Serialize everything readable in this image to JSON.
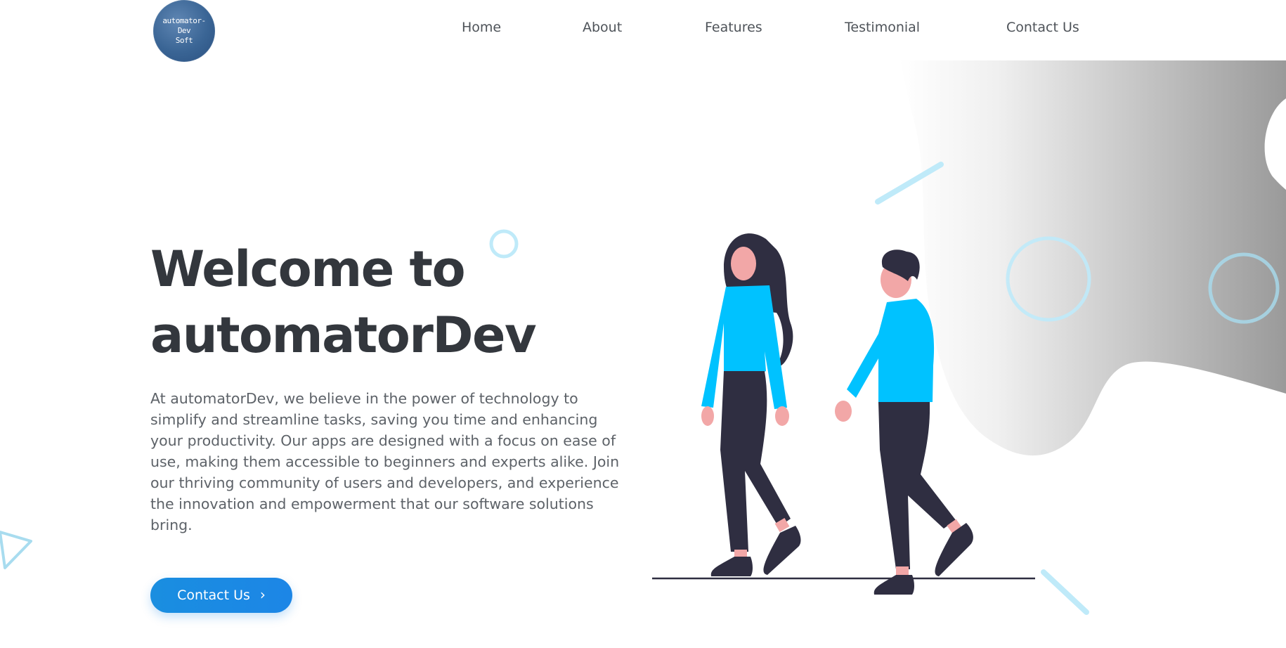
{
  "brand": {
    "logo_text_line1": "automator-Dev",
    "logo_text_line2": "Soft"
  },
  "nav": {
    "items": [
      {
        "label": "Home"
      },
      {
        "label": "About"
      },
      {
        "label": "Features"
      },
      {
        "label": "Testimonial"
      },
      {
        "label": "Contact Us"
      }
    ]
  },
  "hero": {
    "title_line1": "Welcome to",
    "title_line2": "automatorDev",
    "description": "At automatorDev, we believe in the power of technology to simplify and streamline tasks, saving you time and enhancing your productivity. Our apps are designed with a focus on ease of use, making them accessible to beginners and experts alike. Join our thriving community of users and developers, and experience the innovation and empowerment that our software solutions bring.",
    "cta_label": "Contact Us",
    "cta_icon": "chevron-right-icon"
  },
  "colors": {
    "accent": "#1a8ee0",
    "figure_shirt": "#00c2ff",
    "figure_pants": "#2f2e41",
    "skin": "#f2a7a7",
    "title": "#33373d",
    "decor_light_blue": "#bfeaf9"
  }
}
